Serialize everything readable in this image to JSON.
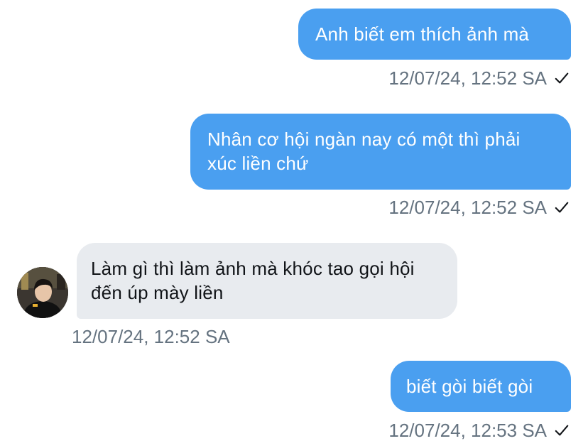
{
  "chat": {
    "messages": [
      {
        "direction": "outgoing",
        "text": "Anh biết em thích ảnh mà",
        "time": "12/07/24, 12:52 SA",
        "status_icon": "check-icon"
      },
      {
        "direction": "outgoing",
        "text": "Nhân cơ hội ngàn nay có một thì phải xúc liền chứ",
        "time": "12/07/24, 12:52 SA",
        "status_icon": "check-icon"
      },
      {
        "direction": "incoming",
        "text": "Làm gì thì làm ảnh mà khóc tao gọi hội đến úp mày liền",
        "time": "12/07/24, 12:52 SA",
        "avatar_icon": "avatar"
      },
      {
        "direction": "outgoing",
        "text": "biết gòi biết gòi",
        "time": "12/07/24, 12:53 SA",
        "status_icon": "check-icon"
      }
    ]
  },
  "colors": {
    "outgoing_bubble": "#4a9ff0",
    "incoming_bubble": "#e8ebef",
    "timestamp": "#657380"
  }
}
